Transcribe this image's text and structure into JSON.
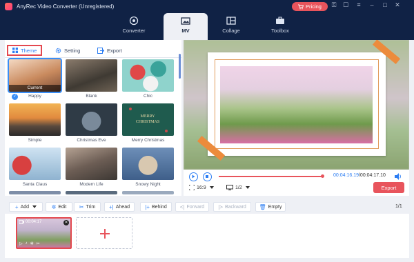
{
  "app": {
    "title": "AnyRec Video Converter (Unregistered)",
    "pricing_label": "Pricing"
  },
  "nav": {
    "tabs": [
      {
        "label": "Converter",
        "icon": "converter-icon"
      },
      {
        "label": "MV",
        "icon": "mv-icon"
      },
      {
        "label": "Collage",
        "icon": "collage-icon"
      },
      {
        "label": "Toolbox",
        "icon": "toolbox-icon"
      }
    ]
  },
  "subtabs": [
    "Theme",
    "Setting",
    "Export"
  ],
  "themes": [
    {
      "label": "Happy",
      "current": "Current"
    },
    {
      "label": "Blank"
    },
    {
      "label": "Chic"
    },
    {
      "label": "Simple"
    },
    {
      "label": "Christmas Eve"
    },
    {
      "label": "Merry Christmas"
    },
    {
      "label": "Santa Claus"
    },
    {
      "label": "Modern Life"
    },
    {
      "label": "Snowy Night"
    }
  ],
  "player": {
    "current_time": "00:04:16.19",
    "total_time": "/00:04:17.10",
    "aspect_ratio": "16:9",
    "screen_split": "1/2",
    "export_label": "Export",
    "progress": 0.98
  },
  "toolbar": {
    "add": "Add",
    "edit": "Edit",
    "trim": "Trim",
    "ahead": "Ahead",
    "behind": "Behind",
    "forward": "Forward",
    "backward": "Backward",
    "empty": "Empty",
    "pager": "1/1"
  },
  "clip": {
    "duration": "00:04:17"
  },
  "colors": {
    "header_bg": "#102245",
    "accent_red": "#e8545c",
    "accent_blue": "#2d7ef3"
  }
}
